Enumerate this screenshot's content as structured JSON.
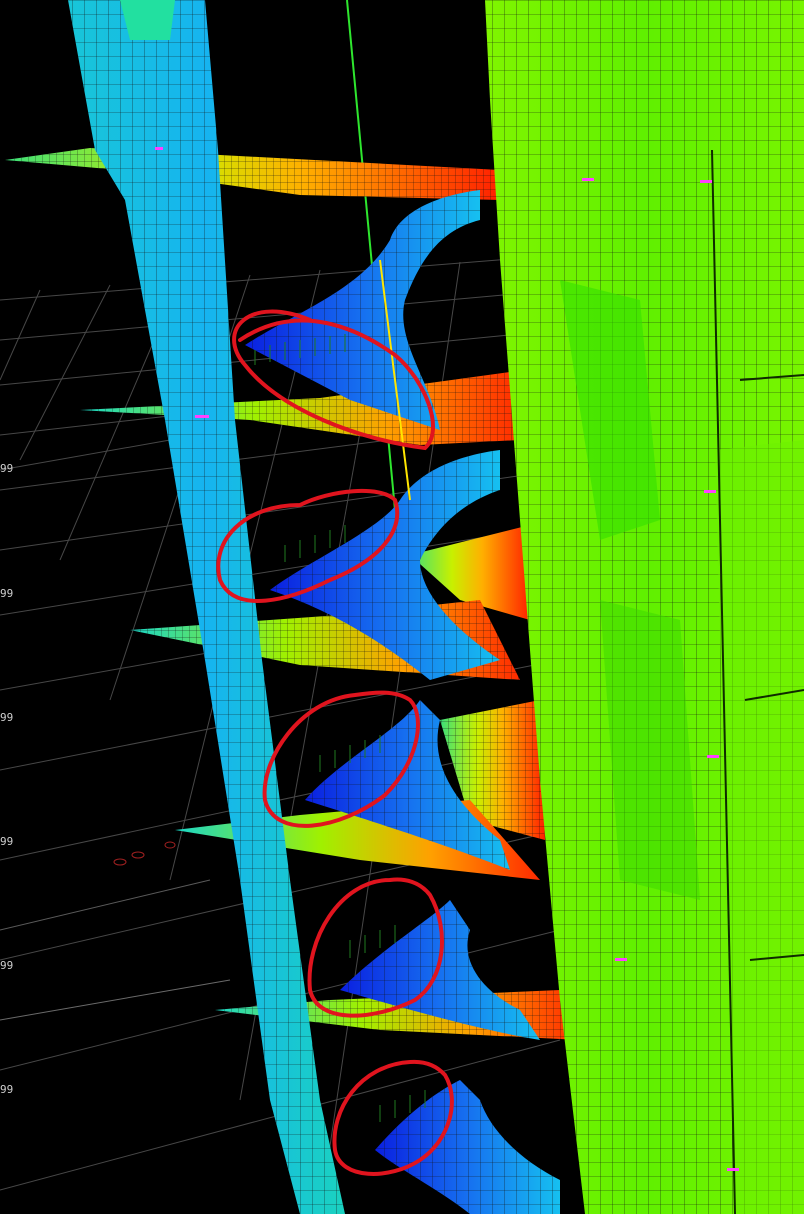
{
  "viewport": {
    "background": "#000000",
    "colors": {
      "grid": "#4a4a4a",
      "cyan_column": "#1ad6c8",
      "light_blue": "#16b8f0",
      "deep_blue": "#0a1fe0",
      "green_core": "#66f500",
      "yellow": "#f2e600",
      "orange": "#ff8c00",
      "red": "#ff1a00",
      "mesh_line": "#1a1a1a",
      "annotation": "#e0141e",
      "axis_green": "#2ee62e",
      "axis_yellow": "#ffe600"
    }
  },
  "level_labels": [
    {
      "text": "99"
    },
    {
      "text": "99"
    },
    {
      "text": "99"
    },
    {
      "text": "99"
    },
    {
      "text": "99"
    },
    {
      "text": "99"
    }
  ],
  "annotation_marks": [
    {
      "id": "circle-1"
    },
    {
      "id": "circle-2"
    },
    {
      "id": "circle-3"
    },
    {
      "id": "circle-4"
    },
    {
      "id": "circle-5"
    }
  ]
}
